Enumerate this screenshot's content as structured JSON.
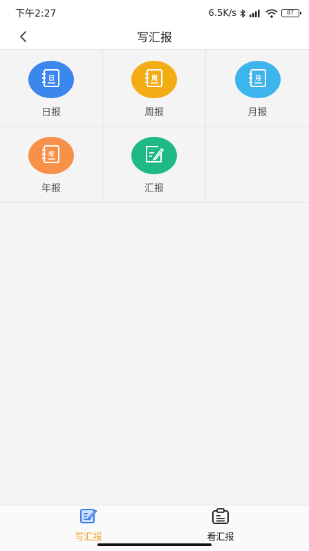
{
  "status_bar": {
    "time": "下午2:27",
    "network_speed": "6.5K/s",
    "battery": "87"
  },
  "nav": {
    "title": "写汇报",
    "back_icon": "chevron-left-icon"
  },
  "grid": {
    "items": [
      {
        "label": "日报",
        "badge": "日",
        "color": "#3b87ee",
        "icon": "notebook-icon"
      },
      {
        "label": "周报",
        "badge": "周",
        "color": "#f4ac14",
        "icon": "notebook-icon"
      },
      {
        "label": "月报",
        "badge": "月",
        "color": "#3eb4ec",
        "icon": "notebook-icon"
      },
      {
        "label": "年报",
        "badge": "年",
        "color": "#f7914a",
        "icon": "notebook-icon"
      },
      {
        "label": "汇报",
        "badge": "",
        "color": "#1fb986",
        "icon": "edit-icon"
      }
    ]
  },
  "tabbar": {
    "tabs": [
      {
        "label": "写汇报",
        "active": true,
        "icon": "write-report-icon",
        "color": "#f0a020"
      },
      {
        "label": "看汇报",
        "active": false,
        "icon": "view-report-icon",
        "color": "#222222"
      }
    ]
  }
}
